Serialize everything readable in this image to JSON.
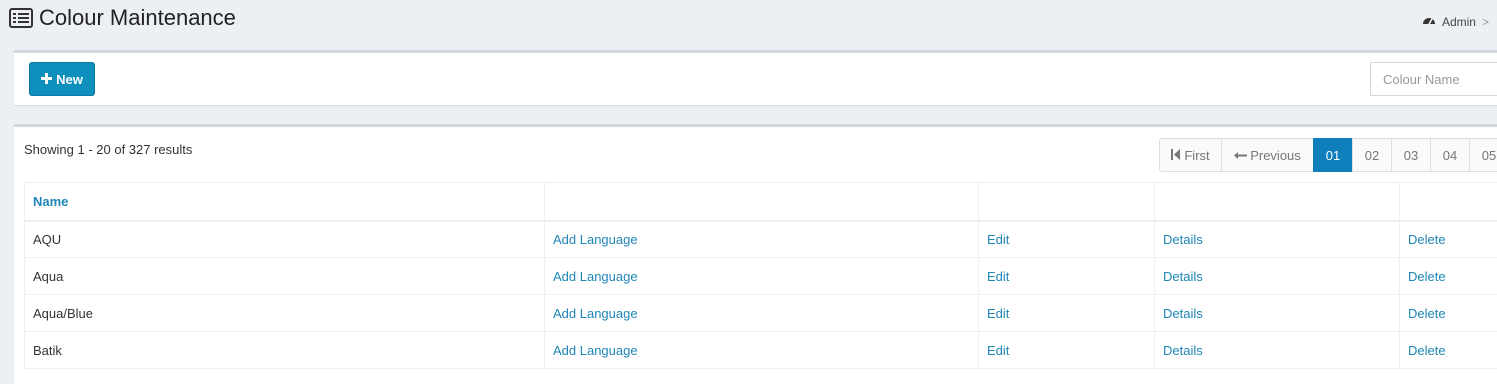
{
  "header": {
    "title": "Colour Maintenance",
    "title_icon": "list-icon",
    "breadcrumb": {
      "icon": "dashboard-icon",
      "label": "Admin",
      "separator": ">"
    }
  },
  "toolbar": {
    "new_label": "New",
    "new_icon": "plus-icon",
    "search_placeholder": "Colour Name"
  },
  "results": {
    "summary": "Showing 1 - 20 of 327 results"
  },
  "pagination": {
    "first_label": "First",
    "previous_label": "Previous",
    "pages": [
      "01",
      "02",
      "03",
      "04",
      "05"
    ],
    "current": "01"
  },
  "table": {
    "columns": [
      "Name",
      "",
      "",
      "",
      ""
    ],
    "rows": [
      {
        "name": "AQU",
        "add_language": "Add Language",
        "edit": "Edit",
        "details": "Details",
        "delete": "Delete"
      },
      {
        "name": "Aqua",
        "add_language": "Add Language",
        "edit": "Edit",
        "details": "Details",
        "delete": "Delete"
      },
      {
        "name": "Aqua/Blue",
        "add_language": "Add Language",
        "edit": "Edit",
        "details": "Details",
        "delete": "Delete"
      },
      {
        "name": "Batik",
        "add_language": "Add Language",
        "edit": "Edit",
        "details": "Details",
        "delete": "Delete"
      }
    ]
  },
  "colors": {
    "primary": "#0e8fbd",
    "link": "#1f86b8",
    "background": "#ecf0f5"
  }
}
